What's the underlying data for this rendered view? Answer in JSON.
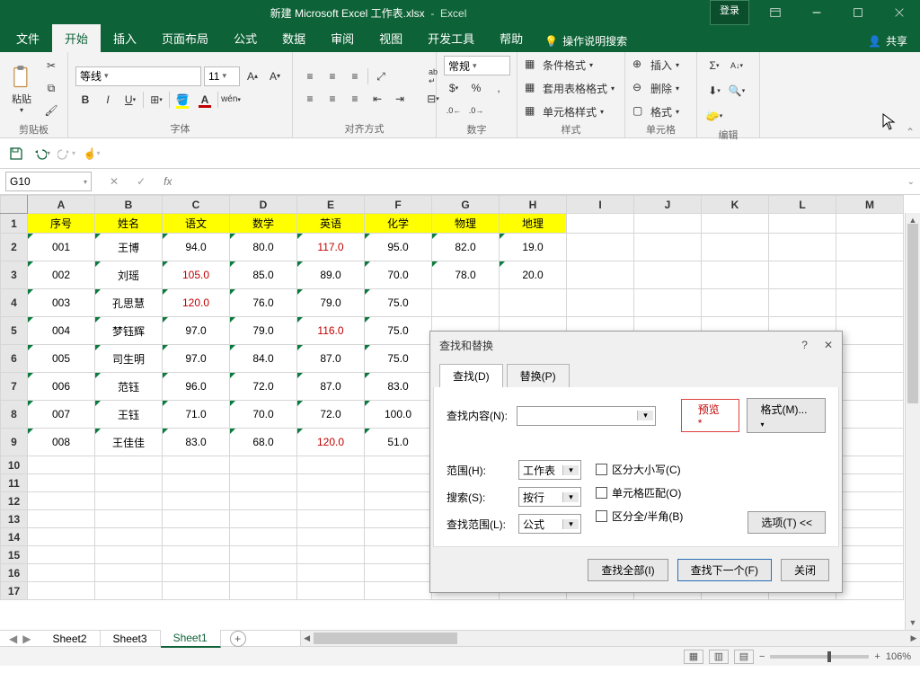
{
  "title": {
    "filename": "新建 Microsoft Excel 工作表.xlsx",
    "app": "Excel"
  },
  "titlebar": {
    "login": "登录"
  },
  "tabs": {
    "file": "文件",
    "home": "开始",
    "insert": "插入",
    "layout": "页面布局",
    "formula": "公式",
    "data": "数据",
    "review": "审阅",
    "view": "视图",
    "dev": "开发工具",
    "help": "帮助",
    "tellme_icon": "💡",
    "tellme": "操作说明搜索",
    "share": "共享"
  },
  "ribbon": {
    "clipboard": {
      "paste": "粘贴",
      "label": "剪贴板"
    },
    "font": {
      "family": "等线",
      "size": "11",
      "label": "字体"
    },
    "align": {
      "label": "对齐方式"
    },
    "number": {
      "format": "常规",
      "label": "数字"
    },
    "style": {
      "cond": "条件格式",
      "tbl": "套用表格格式",
      "cell": "单元格样式",
      "label": "样式"
    },
    "cells": {
      "ins": "插入",
      "del": "删除",
      "fmt": "格式",
      "label": "单元格"
    },
    "edit": {
      "label": "编辑"
    }
  },
  "namebox": "G10",
  "columns": [
    "A",
    "B",
    "C",
    "D",
    "E",
    "F",
    "G",
    "H",
    "I",
    "J",
    "K",
    "L",
    "M"
  ],
  "header_row": [
    "序号",
    "姓名",
    "语文",
    "数学",
    "英语",
    "化学",
    "物理",
    "地理"
  ],
  "rows": [
    {
      "n": "001",
      "name": "王博",
      "c": "94.0",
      "d": "80.0",
      "e": "117.0",
      "e_red": true,
      "f": "95.0",
      "g": "82.0",
      "h": "19.0"
    },
    {
      "n": "002",
      "name": "刘瑶",
      "c": "105.0",
      "c_red": true,
      "d": "85.0",
      "e": "89.0",
      "f": "70.0",
      "g": "78.0",
      "h": "20.0"
    },
    {
      "n": "003",
      "name": "孔思慧",
      "c": "120.0",
      "c_red": true,
      "d": "76.0",
      "e": "79.0",
      "f": "75.0"
    },
    {
      "n": "004",
      "name": "梦钰辉",
      "c": "97.0",
      "d": "79.0",
      "e": "116.0",
      "e_red": true,
      "f": "75.0"
    },
    {
      "n": "005",
      "name": "司生明",
      "c": "97.0",
      "d": "84.0",
      "e": "87.0",
      "f": "75.0"
    },
    {
      "n": "006",
      "name": "范钰",
      "c": "96.0",
      "d": "72.0",
      "e": "87.0",
      "f": "83.0"
    },
    {
      "n": "007",
      "name": "王钰",
      "c": "71.0",
      "d": "70.0",
      "e": "72.0",
      "f": "100.0"
    },
    {
      "n": "008",
      "name": "王佳佳",
      "c": "83.0",
      "d": "68.0",
      "e": "120.0",
      "e_red": true,
      "f": "51.0"
    }
  ],
  "sheets": {
    "s2": "Sheet2",
    "s3": "Sheet3",
    "s1": "Sheet1"
  },
  "status": {
    "zoom": "106%"
  },
  "dialog": {
    "title": "查找和替换",
    "tab_find": "查找(D)",
    "tab_replace": "替换(P)",
    "find_label": "查找内容(N):",
    "preview": "预览*",
    "format_btn": "格式(M)...",
    "scope_label": "范围(H):",
    "scope_val": "工作表",
    "search_label": "搜索(S):",
    "search_val": "按行",
    "lookin_label": "查找范围(L):",
    "lookin_val": "公式",
    "chk_case": "区分大小写(C)",
    "chk_whole": "单元格匹配(O)",
    "chk_width": "区分全/半角(B)",
    "options": "选项(T) <<",
    "find_all": "查找全部(I)",
    "find_next": "查找下一个(F)",
    "close": "关闭"
  }
}
